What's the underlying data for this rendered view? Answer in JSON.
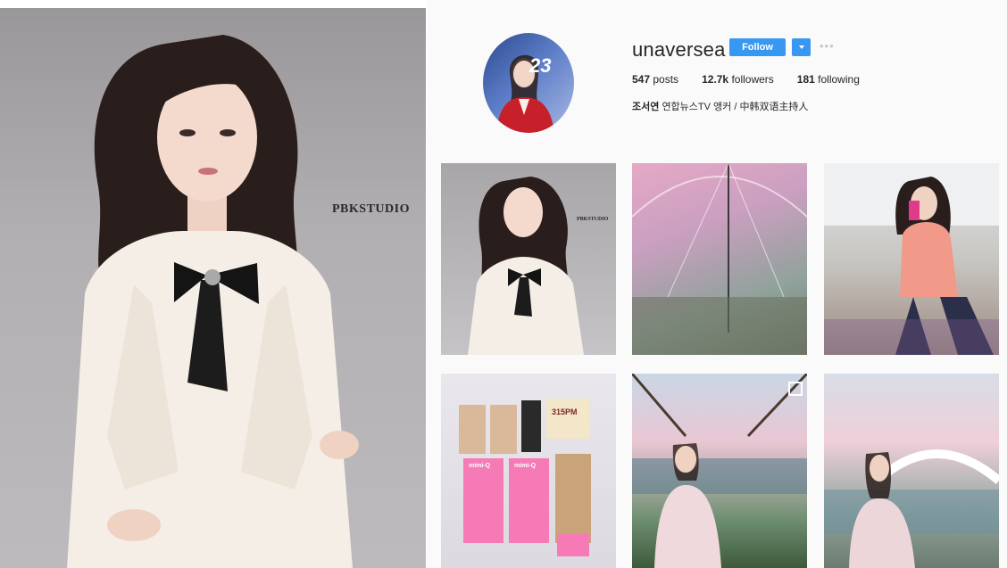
{
  "hero": {
    "watermark": "PBKSTUDIO"
  },
  "profile": {
    "username": "unaversea",
    "follow_label": "Follow",
    "more_label": "•••",
    "posts_count": "547",
    "posts_label": "posts",
    "followers_count": "12.7k",
    "followers_label": "followers",
    "following_count": "181",
    "following_label": "following",
    "bio_name": "조서연",
    "bio_text": "연합뉴스TV 앵커 / 中韩双语主持人",
    "avatar_text": "23"
  },
  "grid": {
    "post1_watermark": "PBKSTUDIO",
    "post4_labels": [
      "mimi-Q",
      "mimi-Q",
      "315PM"
    ]
  },
  "colors": {
    "accent": "#3897f0",
    "text": "#262626",
    "panel_bg": "#fafafa"
  }
}
